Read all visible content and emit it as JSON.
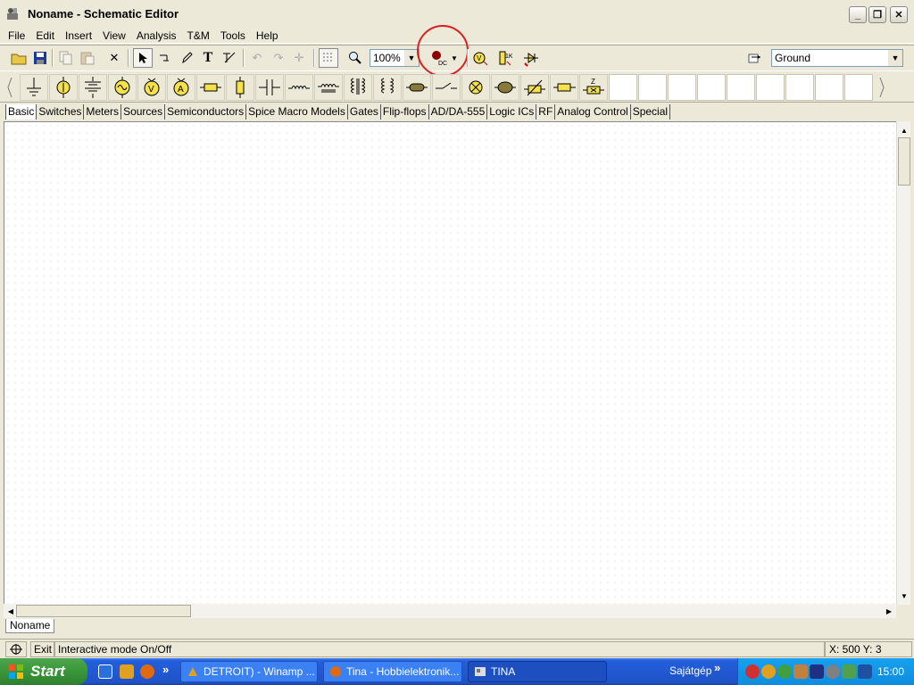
{
  "window": {
    "title": "Noname - Schematic Editor",
    "minimize_label": "_",
    "restore_label": "❐",
    "close_label": "✕"
  },
  "menu": [
    "File",
    "Edit",
    "Insert",
    "View",
    "Analysis",
    "T&M",
    "Tools",
    "Help"
  ],
  "toolbar": {
    "zoom_value": "100%",
    "ground_value": "Ground",
    "highlight_color": "#d92020"
  },
  "component_tabs": [
    "Basic",
    "Switches",
    "Meters",
    "Sources",
    "Semiconductors",
    "Spice Macro Models",
    "Gates",
    "Flip-flops",
    "AD/DA-555",
    "Logic ICs",
    "RF",
    "Analog Control",
    "Special"
  ],
  "document_tab": "Noname",
  "status": {
    "exit_label": "Exit",
    "message": "Interactive mode On/Off",
    "coords": "X: 500  Y: 3"
  },
  "taskbar": {
    "start_label": "Start",
    "chevron": "»",
    "tasks": [
      {
        "label": "DETROIT) - Winamp ..."
      },
      {
        "label": "Tina - Hobbielektronik..."
      },
      {
        "label": "TINA"
      }
    ],
    "desktop_label": "Sajátgép",
    "clock": "15:00"
  }
}
